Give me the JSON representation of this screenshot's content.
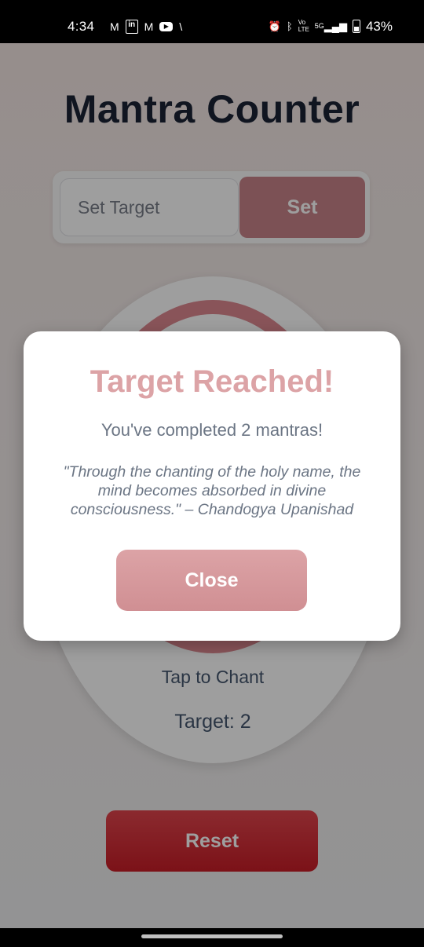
{
  "status_bar": {
    "time": "4:34",
    "left_icons": [
      "gmail-icon",
      "linkedin-icon",
      "gmail-icon",
      "youtube-icon",
      "x-icon"
    ],
    "right_icons": [
      "alarm-icon",
      "bluetooth-icon",
      "volte-icon",
      "5g-signal-icon",
      "battery-icon"
    ],
    "volte_text": "Vo LTE",
    "network_text": "5G",
    "battery_percent": "43%"
  },
  "app": {
    "title": "Mantra Counter",
    "target_input": {
      "placeholder": "Set Target",
      "value": ""
    },
    "set_button_label": "Set",
    "tap_label": "Tap to Chant",
    "target_label": "Target: 2",
    "reset_button_label": "Reset",
    "colors": {
      "accent": "#dd8890",
      "set_button": "#c8848a",
      "reset_button": "#d52e37",
      "title": "#1a2235"
    }
  },
  "modal": {
    "title": "Target Reached!",
    "message": "You've completed 2 mantras!",
    "quote": "\"Through the chanting of the holy name, the mind becomes absorbed in divine consciousness.\" – Chandogya Upanishad",
    "close_button_label": "Close",
    "colors": {
      "title": "#dca3a6",
      "button": "#d59a9e"
    }
  }
}
